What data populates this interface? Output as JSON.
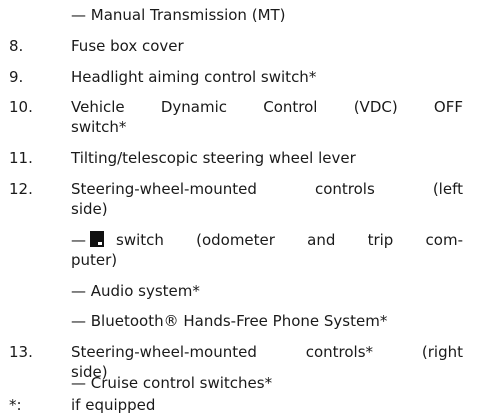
{
  "entries": [
    {
      "text": "— Manual Transmission (MT)"
    },
    {
      "num": "8.",
      "text": "Fuse box cover"
    },
    {
      "num": "9.",
      "text": "Headlight aiming control switch*"
    },
    {
      "num": "10.",
      "text_words": [
        "Vehicle",
        "Dynamic",
        "Control",
        "(VDC)",
        "OFF"
      ],
      "text_cont": "switch*"
    },
    {
      "num": "11.",
      "text": "Tilting/telescopic steering wheel lever"
    },
    {
      "num": "12.",
      "text_words": [
        "Steering-wheel-mounted",
        "controls",
        "(left"
      ],
      "text_cont": "side)"
    },
    {
      "sub_prefix": "—",
      "sub_words": [
        "switch",
        "(odometer",
        "and",
        "trip",
        "com-"
      ],
      "sub_cont": "puter)",
      "icon": "odometer-trip-computer-switch-icon"
    },
    {
      "text": "— Audio system*"
    },
    {
      "text": "— Bluetooth® Hands-Free Phone System*"
    },
    {
      "num": "13.",
      "text_words": [
        "Steering-wheel-mounted",
        "controls*",
        "(right"
      ],
      "text_cont": "side)"
    },
    {
      "text": "— Cruise control switches*"
    },
    {
      "num": "*:",
      "text": "if equipped"
    }
  ]
}
